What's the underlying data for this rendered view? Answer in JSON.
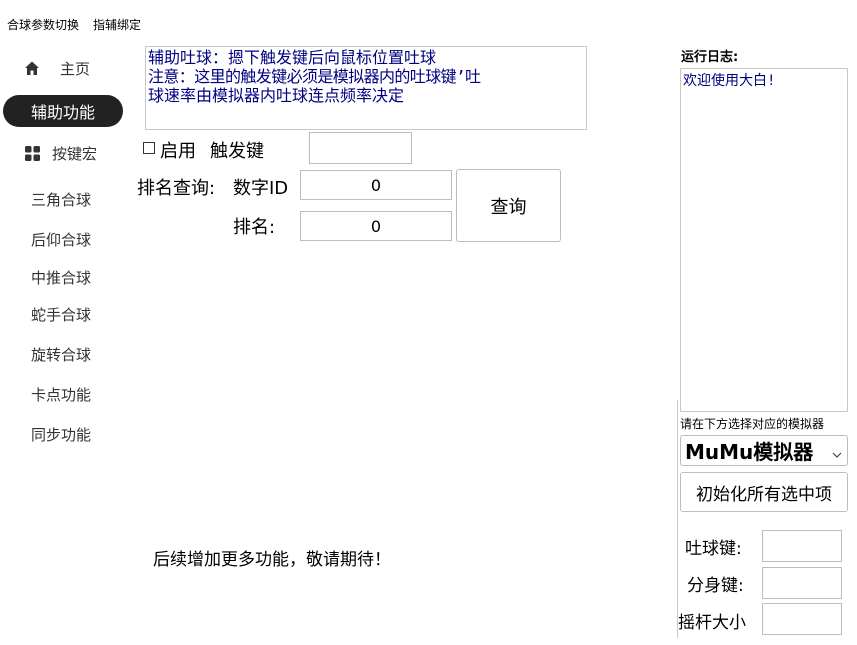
{
  "menu": {
    "item1": "合球参数切换",
    "item2": "指辅绑定"
  },
  "nav": {
    "home": "主页",
    "active": "辅助功能",
    "macro": "按键宏",
    "items": [
      "三角合球",
      "后仰合球",
      "中推合球",
      "蛇手合球",
      "旋转合球",
      "卡点功能",
      "同步功能"
    ]
  },
  "assist": {
    "notice_line1": "辅助吐球：摁下触发键后向鼠标位置吐球",
    "notice_line2": "注意：这里的触发键必须是模拟器内的吐球键’吐",
    "notice_line3": "球速率由模拟器内吐球连点频率决定",
    "enable_label": "启用",
    "trigger_label": "触发键",
    "trigger_value": "",
    "rank_query_label": "排名查询:",
    "id_label": "数字ID",
    "id_value": "0",
    "rank_label": "排名:",
    "rank_value": "0",
    "query_button": "查询",
    "footer_text": "后续增加更多功能，敬请期待！"
  },
  "right": {
    "log_title": "运行日志:",
    "log_text": "欢迎使用大白!",
    "select_hint": "请在下方选择对应的模拟器",
    "emulator_value": "MuMu模拟器",
    "init_button": "初始化所有选中项",
    "spit_key_label": "吐球键:",
    "spit_key_value": "",
    "split_key_label": "分身键:",
    "split_key_value": "",
    "joystick_label": "摇杆大小",
    "joystick_value": ""
  },
  "colors": {
    "accent": "#222222",
    "text_blue": "#000080"
  }
}
